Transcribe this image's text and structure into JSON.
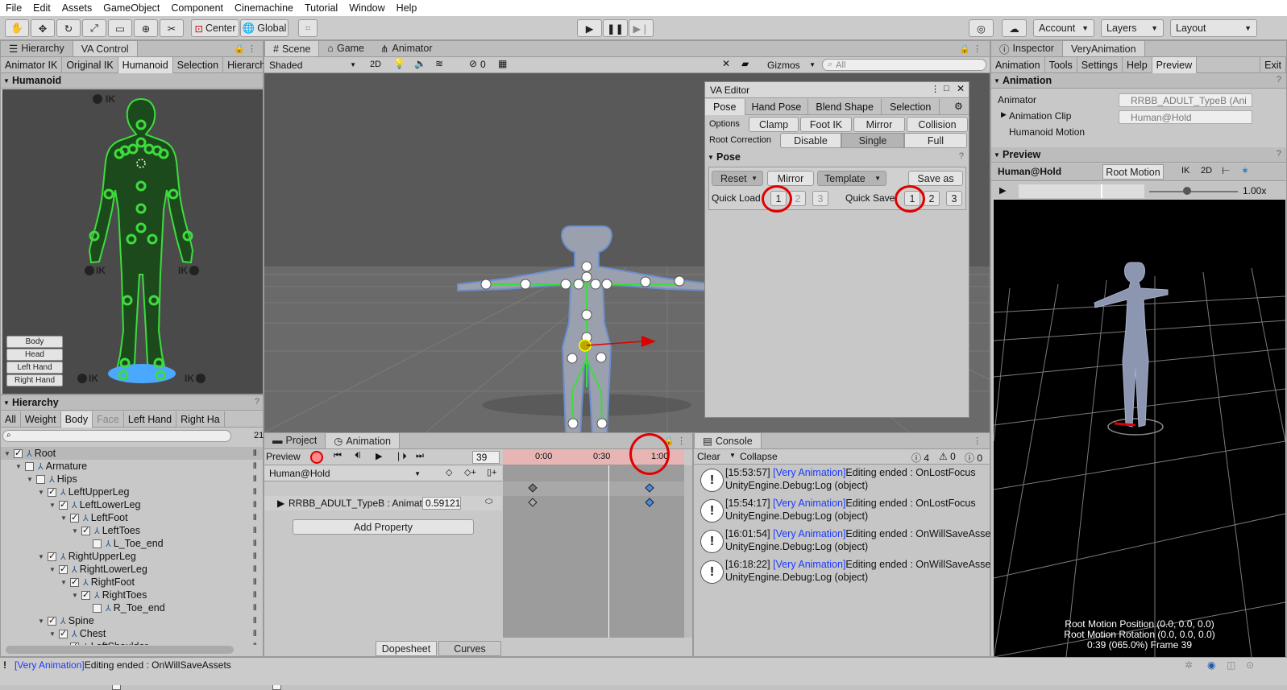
{
  "menu": [
    "File",
    "Edit",
    "Assets",
    "GameObject",
    "Component",
    "Cinemachine",
    "Tutorial",
    "Window",
    "Help"
  ],
  "toolbar": {
    "center": "Center",
    "global": "Global",
    "account": "Account",
    "layers": "Layers",
    "layout": "Layout"
  },
  "left_tabs": {
    "hierarchy": "Hierarchy",
    "vacontrol": "VA Control"
  },
  "va_subtabs": [
    "Animator IK",
    "Original IK",
    "Humanoid",
    "Selection",
    "Hierarchy"
  ],
  "humanoid": {
    "header": "Humanoid",
    "ik": "IK",
    "buttons": [
      "Body",
      "Head",
      "Left Hand",
      "Right Hand"
    ]
  },
  "hierarchy": {
    "header": "Hierarchy",
    "filters": [
      "All",
      "Weight",
      "Body",
      "Face",
      "Left Hand",
      "Right Ha"
    ],
    "count": "21",
    "rows": [
      {
        "label": "Root",
        "d": 0,
        "c": true,
        "arr": "▼"
      },
      {
        "label": "Armature",
        "d": 1,
        "c": false,
        "arr": "▼"
      },
      {
        "label": "Hips",
        "d": 2,
        "c": false,
        "arr": "▼"
      },
      {
        "label": "LeftUpperLeg",
        "d": 3,
        "c": true,
        "arr": "▼"
      },
      {
        "label": "LeftLowerLeg",
        "d": 4,
        "c": true,
        "arr": "▼"
      },
      {
        "label": "LeftFoot",
        "d": 5,
        "c": true,
        "arr": "▼"
      },
      {
        "label": "LeftToes",
        "d": 6,
        "c": true,
        "arr": "▼"
      },
      {
        "label": "L_Toe_end",
        "d": 7,
        "c": false,
        "arr": ""
      },
      {
        "label": "RightUpperLeg",
        "d": 3,
        "c": true,
        "arr": "▼"
      },
      {
        "label": "RightLowerLeg",
        "d": 4,
        "c": true,
        "arr": "▼"
      },
      {
        "label": "RightFoot",
        "d": 5,
        "c": true,
        "arr": "▼"
      },
      {
        "label": "RightToes",
        "d": 6,
        "c": true,
        "arr": "▼"
      },
      {
        "label": "R_Toe_end",
        "d": 7,
        "c": false,
        "arr": ""
      },
      {
        "label": "Spine",
        "d": 3,
        "c": true,
        "arr": "▼"
      },
      {
        "label": "Chest",
        "d": 4,
        "c": true,
        "arr": "▼"
      },
      {
        "label": "LeftShoulder",
        "d": 5,
        "c": true,
        "arr": "▼"
      }
    ]
  },
  "scene": {
    "tabs": [
      "Scene",
      "Game",
      "Animator"
    ],
    "shading": "Shaded",
    "mode2d": "2D",
    "hidden_count": "0",
    "gizmos": "Gizmos",
    "search_placeholder": "All"
  },
  "va_editor": {
    "title": "VA Editor",
    "tabs": [
      "Pose",
      "Hand Pose",
      "Blend Shape",
      "Selection"
    ],
    "options_label": "Options",
    "options": [
      "Clamp",
      "Foot IK",
      "Mirror",
      "Collision"
    ],
    "root_label": "Root Correction",
    "root": [
      "Disable",
      "Single",
      "Full"
    ],
    "pose_header": "Pose",
    "reset": "Reset",
    "mirror": "Mirror",
    "template": "Template",
    "save_as": "Save as",
    "quick_load": "Quick Load",
    "quick_save": "Quick Save",
    "slots": [
      "1",
      "2",
      "3"
    ]
  },
  "animation": {
    "tabs": [
      "Project",
      "Animation"
    ],
    "preview": "Preview",
    "frame": "39",
    "ticks": [
      "0:00",
      "0:30",
      "1:00"
    ],
    "clip": "Human@Hold",
    "property": "RRBB_ADULT_TypeB : Animat",
    "value": "0.59121",
    "add_property": "Add Property",
    "dopesheet": "Dopesheet",
    "curves": "Curves"
  },
  "console": {
    "tab": "Console",
    "clear": "Clear",
    "collapse": "Collapse",
    "counts": [
      "4",
      "0",
      "0"
    ],
    "logs": [
      {
        "time": "[15:53:57]",
        "src": "[Very Animation]",
        "msg": "Editing ended : OnLostFocus",
        "trace": "UnityEngine.Debug:Log (object)"
      },
      {
        "time": "[15:54:17]",
        "src": "[Very Animation]",
        "msg": "Editing ended : OnLostFocus",
        "trace": "UnityEngine.Debug:Log (object)"
      },
      {
        "time": "[16:01:54]",
        "src": "[Very Animation]",
        "msg": "Editing ended : OnWillSaveAssets",
        "trace": "UnityEngine.Debug:Log (object)"
      },
      {
        "time": "[16:18:22]",
        "src": "[Very Animation]",
        "msg": "Editing ended : OnWillSaveAssets",
        "trace": "UnityEngine.Debug:Log (object)"
      }
    ]
  },
  "inspector": {
    "tabs": [
      "Inspector",
      "VeryAnimation"
    ],
    "subtabs": [
      "Animation",
      "Tools",
      "Settings",
      "Help",
      "Preview"
    ],
    "exit": "Exit",
    "animation_header": "Animation",
    "animator_label": "Animator",
    "animator_value": "RRBB_ADULT_TypeB (Ani",
    "clip_label": "Animation Clip",
    "clip_value": "Human@Hold",
    "humanoid_motion": "Humanoid Motion",
    "preview_header": "Preview",
    "preview_name": "Human@Hold",
    "root_motion": "Root Motion",
    "ik": "IK",
    "mode2d": "2D",
    "speed": "1.00x",
    "overlay": [
      "Root Motion Position (0.0, 0.0, 0.0)",
      "Root Motion Rotation (0.0, 0.0, 0.0)",
      "0:39 (065.0%) Frame 39"
    ]
  },
  "status": {
    "src": "[Very Animation]",
    "msg": "Editing ended : OnWillSaveAssets"
  }
}
